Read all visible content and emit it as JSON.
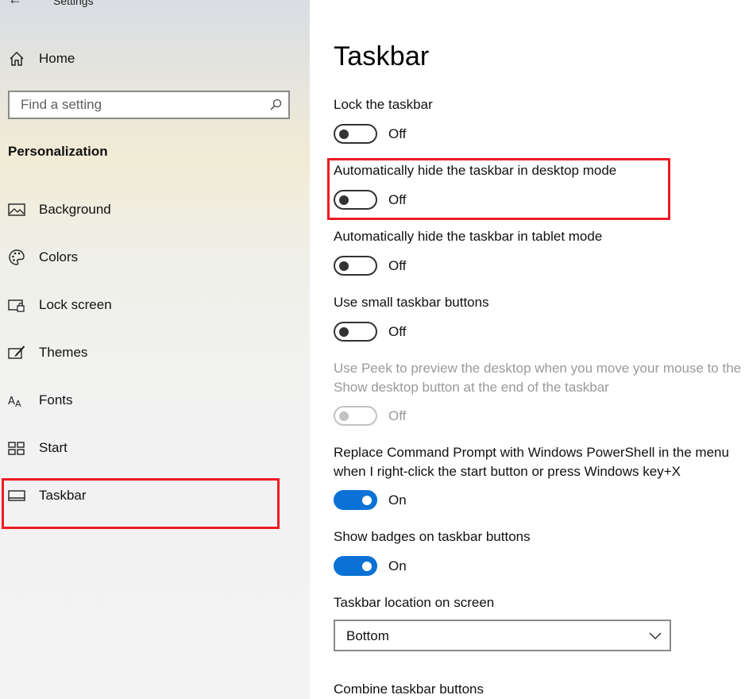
{
  "window": {
    "title": "Settings"
  },
  "sidebar": {
    "home_label": "Home",
    "search_placeholder": "Find a setting",
    "section_heading": "Personalization",
    "items": [
      {
        "label": "Background",
        "icon": "image-icon"
      },
      {
        "label": "Colors",
        "icon": "palette-icon"
      },
      {
        "label": "Lock screen",
        "icon": "lock-screen-icon"
      },
      {
        "label": "Themes",
        "icon": "themes-icon"
      },
      {
        "label": "Fonts",
        "icon": "fonts-icon"
      },
      {
        "label": "Start",
        "icon": "start-icon"
      },
      {
        "label": "Taskbar",
        "icon": "taskbar-icon",
        "selected": true
      }
    ]
  },
  "main": {
    "title": "Taskbar",
    "settings": [
      {
        "label": "Lock the taskbar",
        "state": "Off",
        "on": false
      },
      {
        "label": "Automatically hide the taskbar in desktop mode",
        "state": "Off",
        "on": false,
        "highlighted": true
      },
      {
        "label": "Automatically hide the taskbar in tablet mode",
        "state": "Off",
        "on": false
      },
      {
        "label": "Use small taskbar buttons",
        "state": "Off",
        "on": false
      },
      {
        "label_line1": "Use Peek to preview the desktop when you move your mouse to the",
        "label_line2": "Show desktop button at the end of the taskbar",
        "state": "Off",
        "on": false,
        "disabled": true
      },
      {
        "label_line1": "Replace Command Prompt with Windows PowerShell in the menu",
        "label_line2": "when I right-click the start button or press Windows key+X",
        "state": "On",
        "on": true
      },
      {
        "label": "Show badges on taskbar buttons",
        "state": "On",
        "on": true
      }
    ],
    "location": {
      "label": "Taskbar location on screen",
      "value": "Bottom"
    },
    "combine_label": "Combine taskbar buttons"
  },
  "colors": {
    "accent": "#0a72d6",
    "highlight": "#ee1c25"
  }
}
